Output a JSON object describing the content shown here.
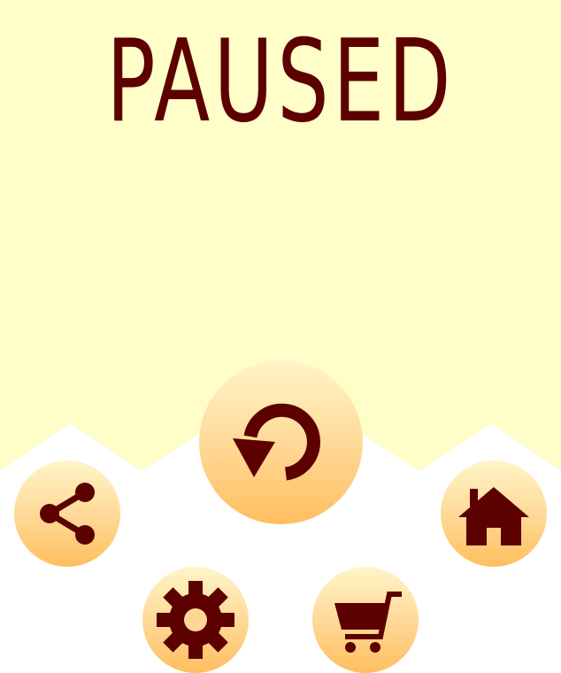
{
  "title": "PAUSED",
  "colors": {
    "background_top": "#fffdc8",
    "background_bottom": "#ffffff",
    "icon": "#5c0000",
    "button_gradient_top": "#fff5c8",
    "button_gradient_bottom": "#ffbe5e"
  },
  "buttons": [
    {
      "name": "restart-button",
      "icon": "restart-icon"
    },
    {
      "name": "share-button",
      "icon": "share-icon"
    },
    {
      "name": "home-button",
      "icon": "home-icon"
    },
    {
      "name": "settings-button",
      "icon": "gear-icon"
    },
    {
      "name": "shop-button",
      "icon": "cart-icon"
    }
  ]
}
